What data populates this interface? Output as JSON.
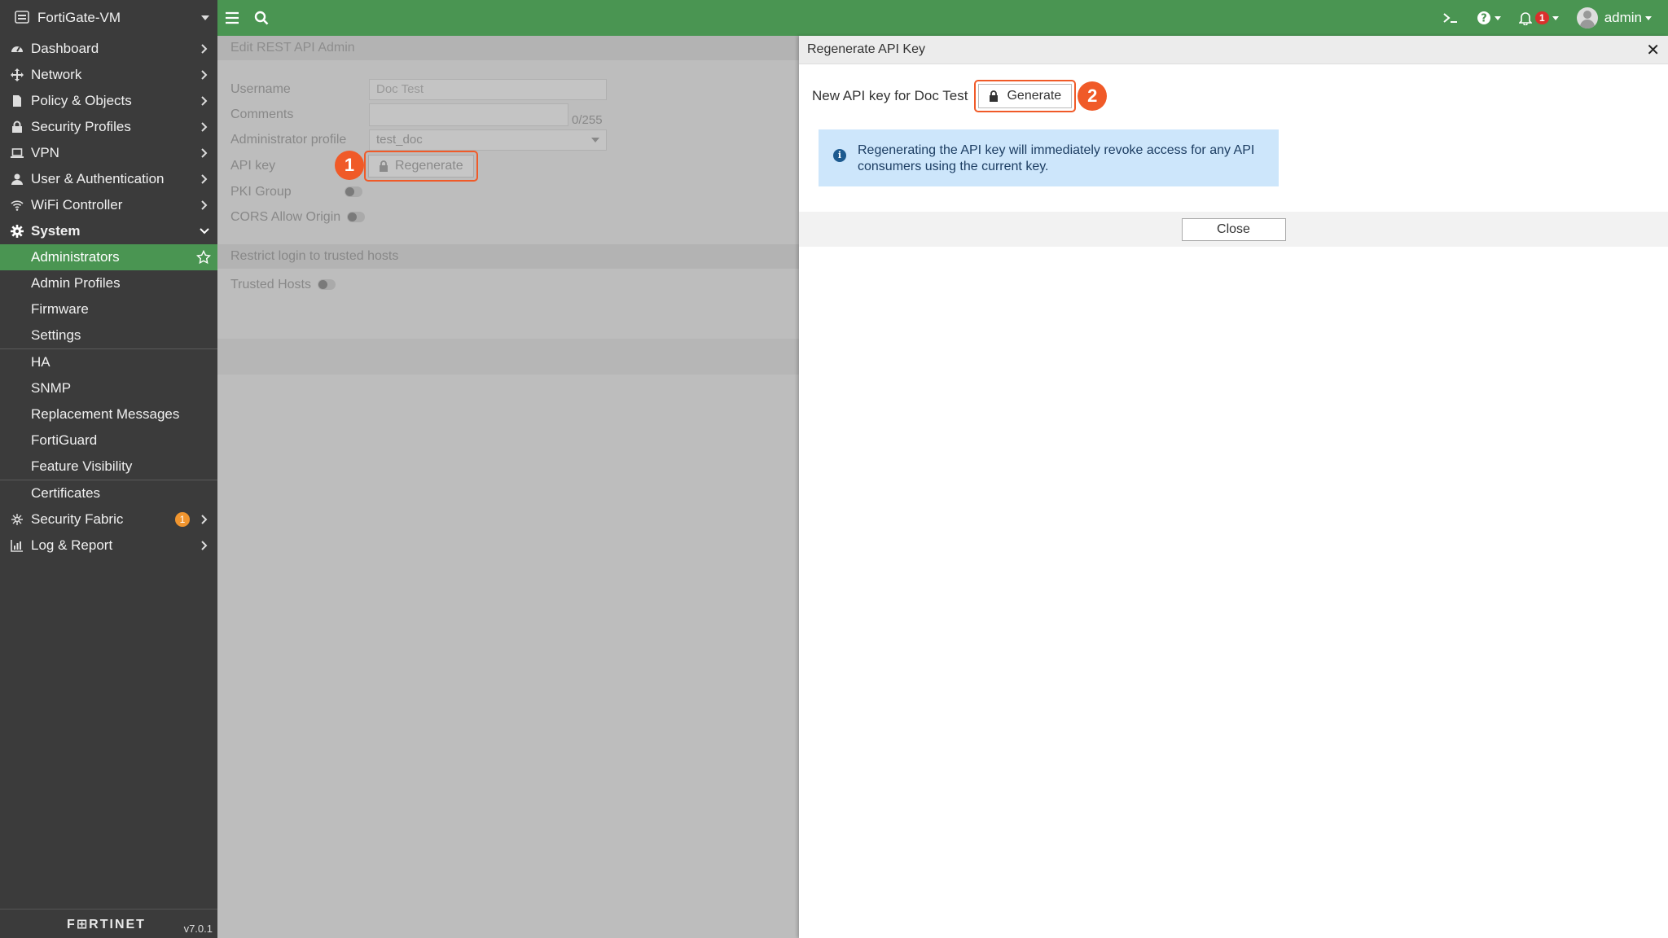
{
  "sidebar": {
    "device_name": "FortiGate-VM",
    "items": [
      {
        "label": "Dashboard",
        "icon": "dashboard-icon"
      },
      {
        "label": "Network",
        "icon": "network-icon"
      },
      {
        "label": "Policy & Objects",
        "icon": "policy-icon"
      },
      {
        "label": "Security Profiles",
        "icon": "lock-icon"
      },
      {
        "label": "VPN",
        "icon": "laptop-icon"
      },
      {
        "label": "User & Authentication",
        "icon": "user-icon"
      },
      {
        "label": "WiFi Controller",
        "icon": "wifi-icon"
      },
      {
        "label": "System",
        "icon": "gear-icon"
      }
    ],
    "system_sub": [
      "Administrators",
      "Admin Profiles",
      "Firmware",
      "Settings",
      "HA",
      "SNMP",
      "Replacement Messages",
      "FortiGuard",
      "Feature Visibility",
      "Certificates"
    ],
    "bottom_items": [
      {
        "label": "Security Fabric",
        "icon": "fabric-icon",
        "badge": "1"
      },
      {
        "label": "Log & Report",
        "icon": "chart-icon"
      }
    ],
    "brand": "F⊞RTINET",
    "version": "v7.0.1"
  },
  "topbar": {
    "notification_count": "1",
    "user": "admin"
  },
  "background_form": {
    "title": "Edit REST API Admin",
    "username_label": "Username",
    "username_value": "Doc Test",
    "comments_label": "Comments",
    "comments_count": "0/255",
    "profile_label": "Administrator profile",
    "profile_value": "test_doc",
    "api_key_label": "API key",
    "regenerate_label": "Regenerate",
    "pki_label": "PKI Group",
    "cors_label": "CORS Allow Origin",
    "restrict_section": "Restrict login to trusted hosts",
    "trusted_label": "Trusted Hosts",
    "callout_1": "1"
  },
  "panel": {
    "title": "Regenerate API Key",
    "new_key_label": "New API key for Doc Test",
    "generate_label": "Generate",
    "callout_2": "2",
    "info_text": "Regenerating the API key will immediately revoke access for any API consumers using the current key.",
    "close_label": "Close"
  },
  "colors": {
    "accent_green": "#4a9552",
    "sidebar_bg": "#3b3b3b",
    "callout_orange": "#f05a28",
    "info_bg": "#cde6fb"
  }
}
